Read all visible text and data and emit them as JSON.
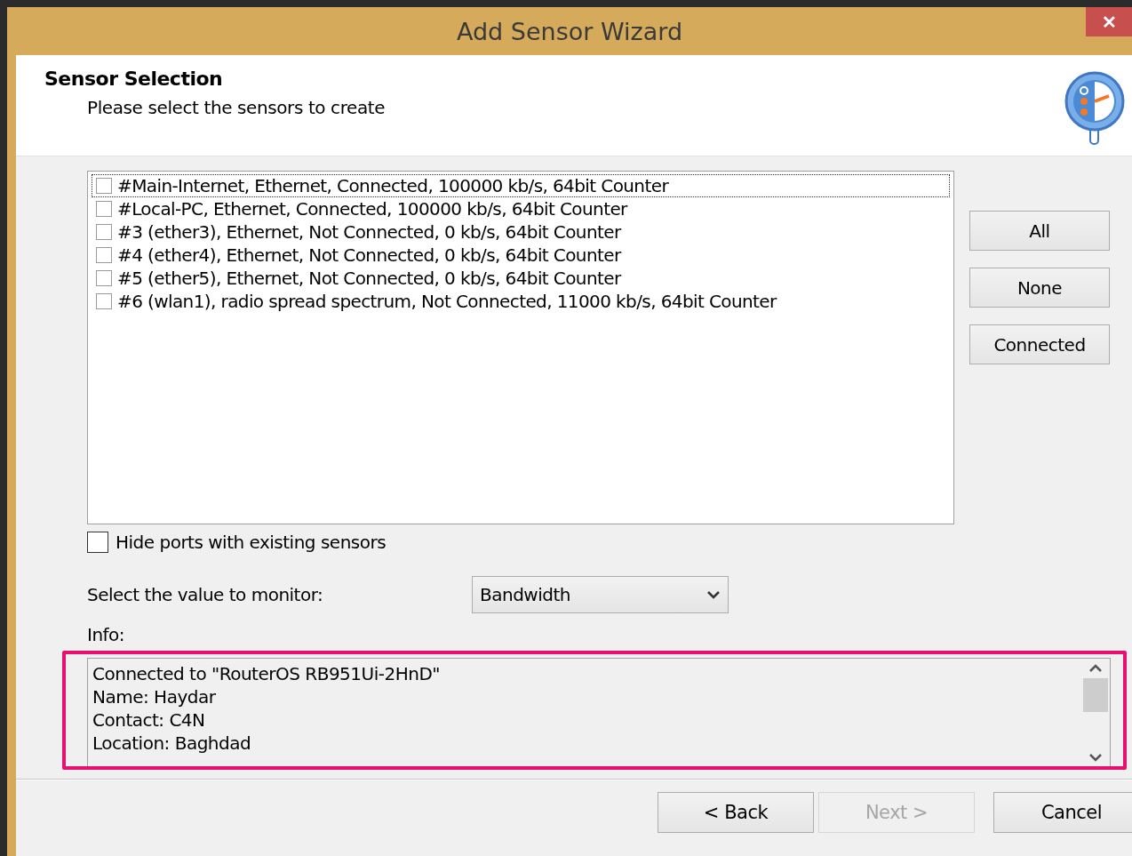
{
  "window": {
    "title": "Add Sensor Wizard",
    "close": "✕"
  },
  "header": {
    "title": "Sensor Selection",
    "subtitle": "Please select the sensors to create"
  },
  "sensors": [
    {
      "label": "#Main-Internet, Ethernet, Connected, 100000 kb/s, 64bit Counter",
      "checked": false,
      "focused": true
    },
    {
      "label": "#Local-PC, Ethernet, Connected, 100000 kb/s, 64bit Counter",
      "checked": false,
      "focused": false
    },
    {
      "label": "#3 (ether3), Ethernet, Not Connected, 0 kb/s, 64bit Counter",
      "checked": false,
      "focused": false
    },
    {
      "label": "#4 (ether4), Ethernet, Not Connected, 0 kb/s, 64bit Counter",
      "checked": false,
      "focused": false
    },
    {
      "label": "#5 (ether5), Ethernet, Not Connected, 0 kb/s, 64bit Counter",
      "checked": false,
      "focused": false
    },
    {
      "label": "#6 (wlan1), radio spread spectrum, Not Connected, 11000 kb/s, 64bit Counter",
      "checked": false,
      "focused": false
    }
  ],
  "side_buttons": [
    "All",
    "None",
    "Connected"
  ],
  "hide_ports": {
    "label": "Hide ports with existing sensors",
    "checked": false
  },
  "monitor": {
    "label": "Select the value to monitor:",
    "value": "Bandwidth"
  },
  "info": {
    "label": "Info:",
    "highlighted": true,
    "lines": [
      "Connected to \"RouterOS RB951Ui-2HnD\"",
      "Name: Haydar",
      "Contact: C4N",
      "Location: Baghdad"
    ]
  },
  "footer_buttons": [
    {
      "label": "< Back",
      "disabled": false
    },
    {
      "label": "Next >",
      "disabled": true
    },
    {
      "label": "Cancel",
      "disabled": false
    }
  ]
}
